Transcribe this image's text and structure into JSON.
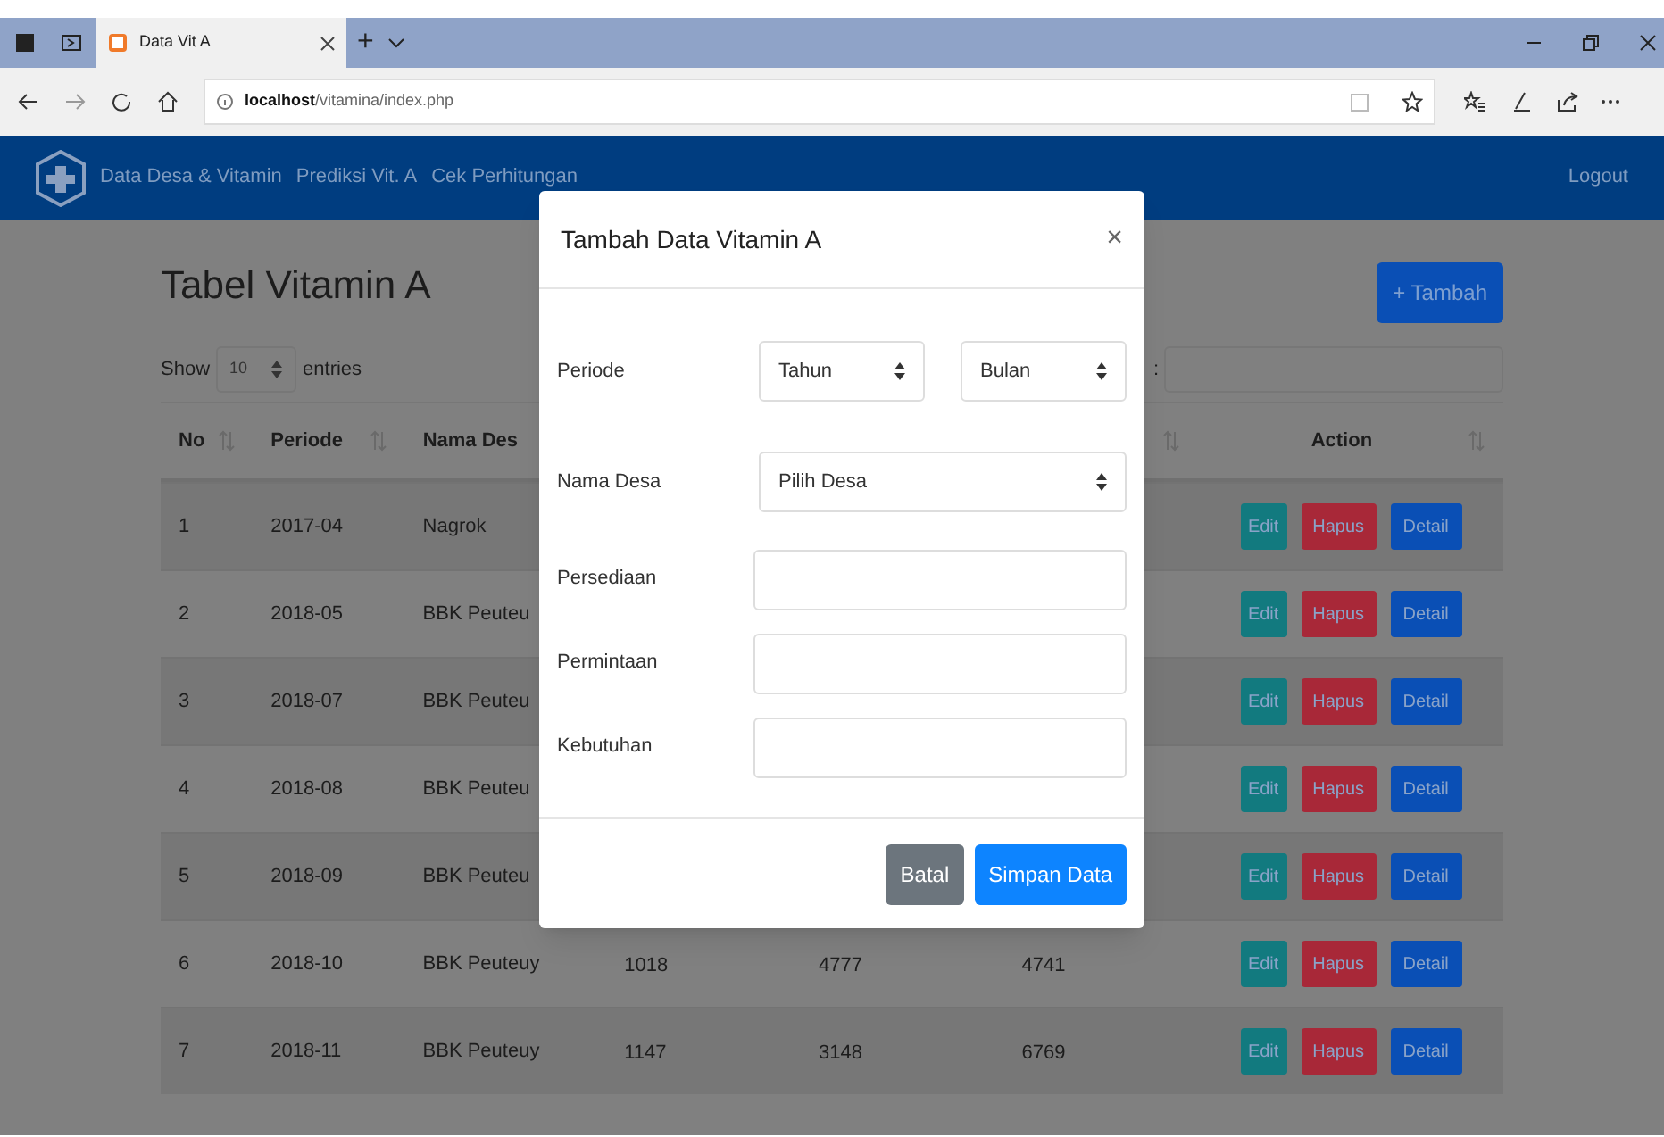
{
  "browser": {
    "tab_title": "Data Vit A",
    "new_tab": "+",
    "url_host": "localhost",
    "url_path": "/vitamina/index.php"
  },
  "nav": {
    "links": [
      "Data Desa & Vitamin",
      "Prediksi Vit. A",
      "Cek Perhitungan"
    ],
    "logout": "Logout"
  },
  "page": {
    "title": "Tabel Vitamin A",
    "add_button": "+ Tambah",
    "show_label": "Show",
    "entries_value": "10",
    "entries_label": "entries",
    "search_label": ":"
  },
  "table": {
    "columns": [
      {
        "label": "No",
        "sortable": true
      },
      {
        "label": "Periode",
        "sortable": true
      },
      {
        "label": "Nama Des"
      },
      {
        "sortable": true
      },
      {
        "label": "Action",
        "sortable": true
      }
    ],
    "rows": [
      {
        "no": "1",
        "periode": "2017-04",
        "nama_desa": "Nagrok",
        "actions": [
          {
            "kind": "edit",
            "label": "Edit"
          },
          {
            "kind": "delete",
            "label": "Hapus"
          },
          {
            "kind": "detail",
            "label": "Detail"
          }
        ]
      },
      {
        "no": "2",
        "periode": "2018-05",
        "nama_desa": "BBK Peuteu",
        "actions": [
          {
            "kind": "edit",
            "label": "Edit"
          },
          {
            "kind": "delete",
            "label": "Hapus"
          },
          {
            "kind": "detail",
            "label": "Detail"
          }
        ]
      },
      {
        "no": "3",
        "periode": "2018-07",
        "nama_desa": "BBK Peuteu",
        "actions": [
          {
            "kind": "edit",
            "label": "Edit"
          },
          {
            "kind": "delete",
            "label": "Hapus"
          },
          {
            "kind": "detail",
            "label": "Detail"
          }
        ]
      },
      {
        "no": "4",
        "periode": "2018-08",
        "nama_desa": "BBK Peuteu",
        "actions": [
          {
            "kind": "edit",
            "label": "Edit"
          },
          {
            "kind": "delete",
            "label": "Hapus"
          },
          {
            "kind": "detail",
            "label": "Detail"
          }
        ]
      },
      {
        "no": "5",
        "periode": "2018-09",
        "nama_desa": "BBK Peuteu",
        "actions": [
          {
            "kind": "edit",
            "label": "Edit"
          },
          {
            "kind": "delete",
            "label": "Hapus"
          },
          {
            "kind": "detail",
            "label": "Detail"
          }
        ]
      },
      {
        "no": "6",
        "periode": "2018-10",
        "nama_desa": "BBK Peuteuy",
        "cells": [
          "1018",
          "4777",
          "4741"
        ],
        "actions": [
          {
            "kind": "edit",
            "label": "Edit"
          },
          {
            "kind": "delete",
            "label": "Hapus"
          },
          {
            "kind": "detail",
            "label": "Detail"
          }
        ]
      },
      {
        "no": "7",
        "periode": "2018-11",
        "nama_desa": "BBK Peuteuy",
        "cells": [
          "1147",
          "3148",
          "6769"
        ],
        "actions": [
          {
            "kind": "edit",
            "label": "Edit"
          },
          {
            "kind": "delete",
            "label": "Hapus"
          },
          {
            "kind": "detail",
            "label": "Detail"
          }
        ]
      }
    ]
  },
  "modal": {
    "title": "Tambah Data Vitamin A",
    "close": "×",
    "fields": [
      {
        "kind": "select-pair",
        "label": "Periode",
        "options": [
          "Tahun",
          "Bulan"
        ]
      },
      {
        "kind": "select",
        "label": "Nama Desa",
        "value": "Pilih Desa"
      },
      {
        "kind": "input",
        "label": "Persediaan"
      },
      {
        "kind": "input",
        "label": "Permintaan"
      },
      {
        "kind": "input",
        "label": "Kebutuhan"
      }
    ],
    "buttons": [
      {
        "kind": "secondary",
        "label": "Batal"
      },
      {
        "kind": "primary",
        "label": "Simpan Data"
      }
    ]
  }
}
